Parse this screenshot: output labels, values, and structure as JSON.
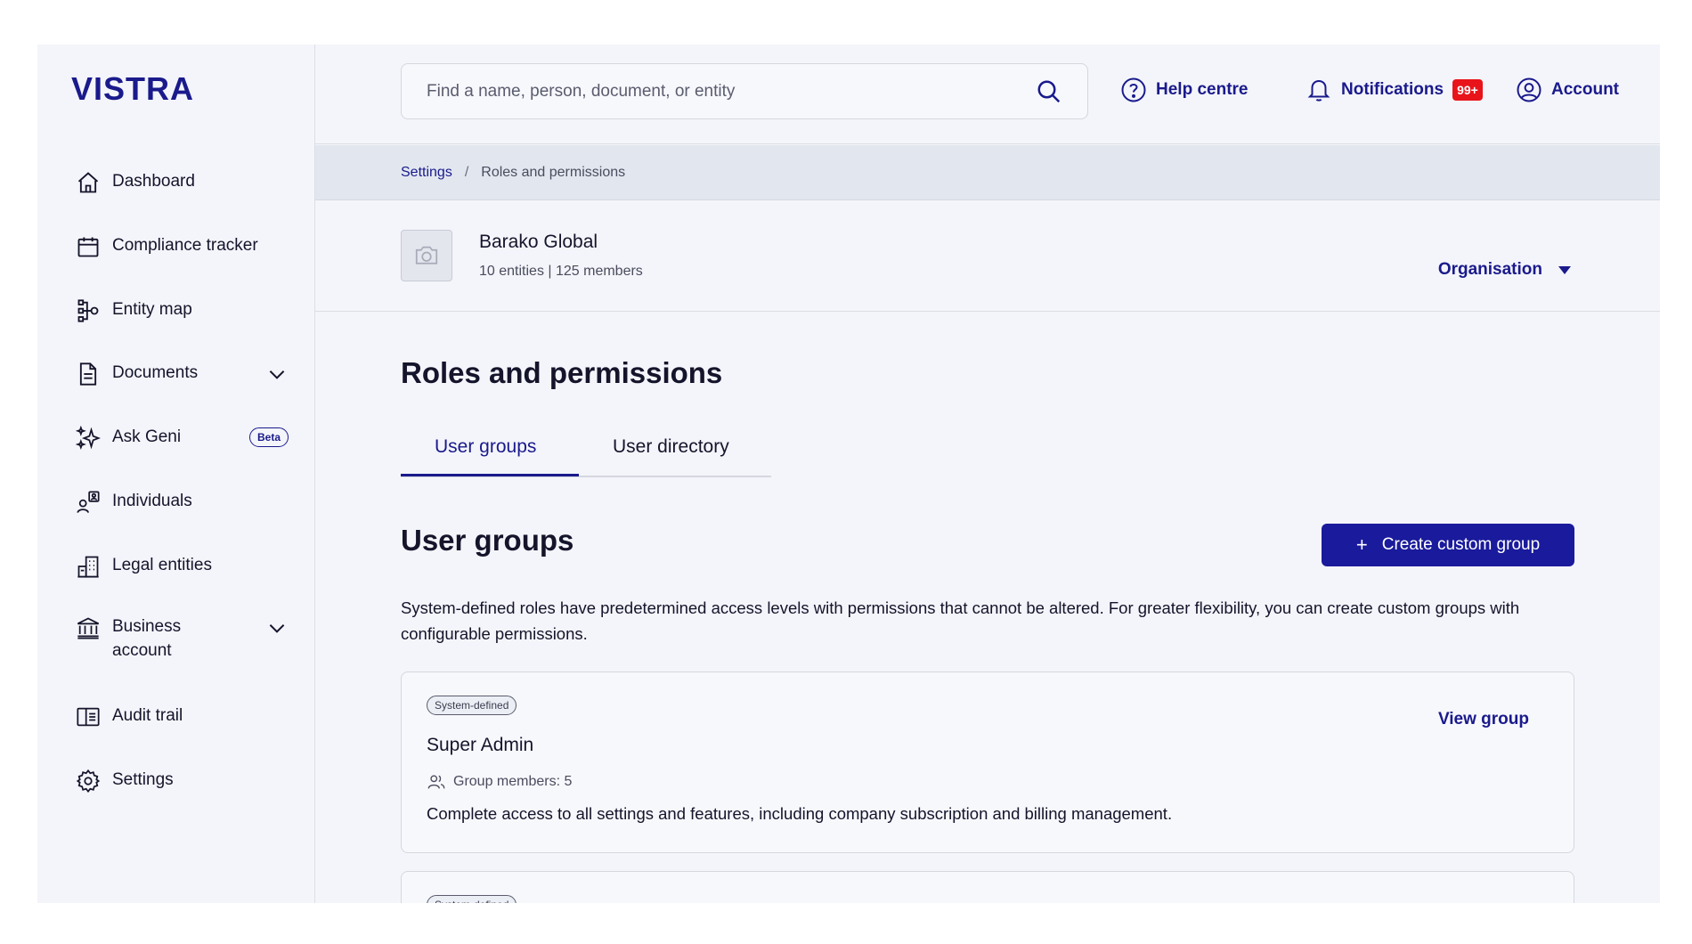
{
  "brand": {
    "logo_text": "VISTRA",
    "accent": "#1a1a8c",
    "button_bg": "#1a1a9c",
    "alert_red": "#e8141a"
  },
  "search": {
    "placeholder": "Find a name, person, document, or entity"
  },
  "topbar": {
    "help_label": "Help centre",
    "notifications_label": "Notifications",
    "notifications_badge": "99+",
    "account_label": "Account"
  },
  "sidebar": {
    "items": [
      {
        "label": "Dashboard",
        "icon": "home-icon"
      },
      {
        "label": "Compliance tracker",
        "icon": "calendar-icon"
      },
      {
        "label": "Entity map",
        "icon": "entity-map-icon"
      },
      {
        "label": "Documents",
        "icon": "document-icon",
        "expandable": true
      },
      {
        "label": "Ask Geni",
        "icon": "sparkle-icon",
        "badge": "Beta"
      },
      {
        "label": "Individuals",
        "icon": "individuals-icon"
      },
      {
        "label": "Legal entities",
        "icon": "building-icon"
      },
      {
        "label": "Business account",
        "icon": "bank-icon",
        "expandable": true
      },
      {
        "label": "Audit trail",
        "icon": "audit-icon"
      },
      {
        "label": "Settings",
        "icon": "gear-icon"
      }
    ]
  },
  "breadcrumb": {
    "parent": "Settings",
    "separator": "/",
    "current": "Roles and permissions"
  },
  "org": {
    "name": "Barako Global",
    "meta": "10 entities | 125 members",
    "selector_label": "Organisation"
  },
  "main": {
    "title": "Roles and permissions",
    "tabs": [
      {
        "label": "User groups",
        "active": true
      },
      {
        "label": "User directory",
        "active": false
      }
    ],
    "section_title": "User groups",
    "create_button": "Create custom group",
    "description": "System-defined roles have predetermined access levels with permissions that cannot be altered. For greater flexibility, you can create custom groups with configurable permissions.",
    "groups": [
      {
        "tag": "System-defined",
        "name": "Super Admin",
        "members": "Group members: 5",
        "description": "Complete access to all settings and features, including company subscription and billing management.",
        "action": "View group"
      },
      {
        "tag": "System-defined"
      }
    ]
  }
}
